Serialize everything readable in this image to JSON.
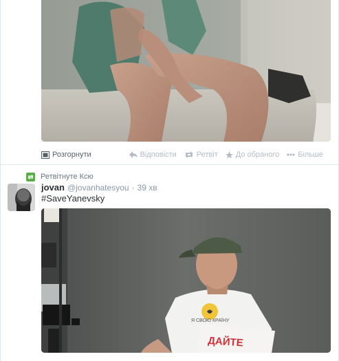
{
  "tweet_top": {
    "actions": {
      "expand": "Розгорнути",
      "reply": "Відповісти",
      "retweet": "Ретвіт",
      "favorite": "До обраного",
      "more": "Більше"
    }
  },
  "tweet_bottom": {
    "retweeted_by": "Ретвітнуте Ксю",
    "fullname": "jovan",
    "username": "@jovanhatesyou",
    "separator": "·",
    "time": "39 хв",
    "text": "#SaveYanevsky",
    "photo": {
      "shirt_text": "Я СВОЮ КРАЇНУ",
      "sign_text": "ДАЙТЕ"
    }
  },
  "colors": {
    "retweet_green": "#5bad4b",
    "muted_text": "#8899a6",
    "divider": "#e1e8ed"
  }
}
